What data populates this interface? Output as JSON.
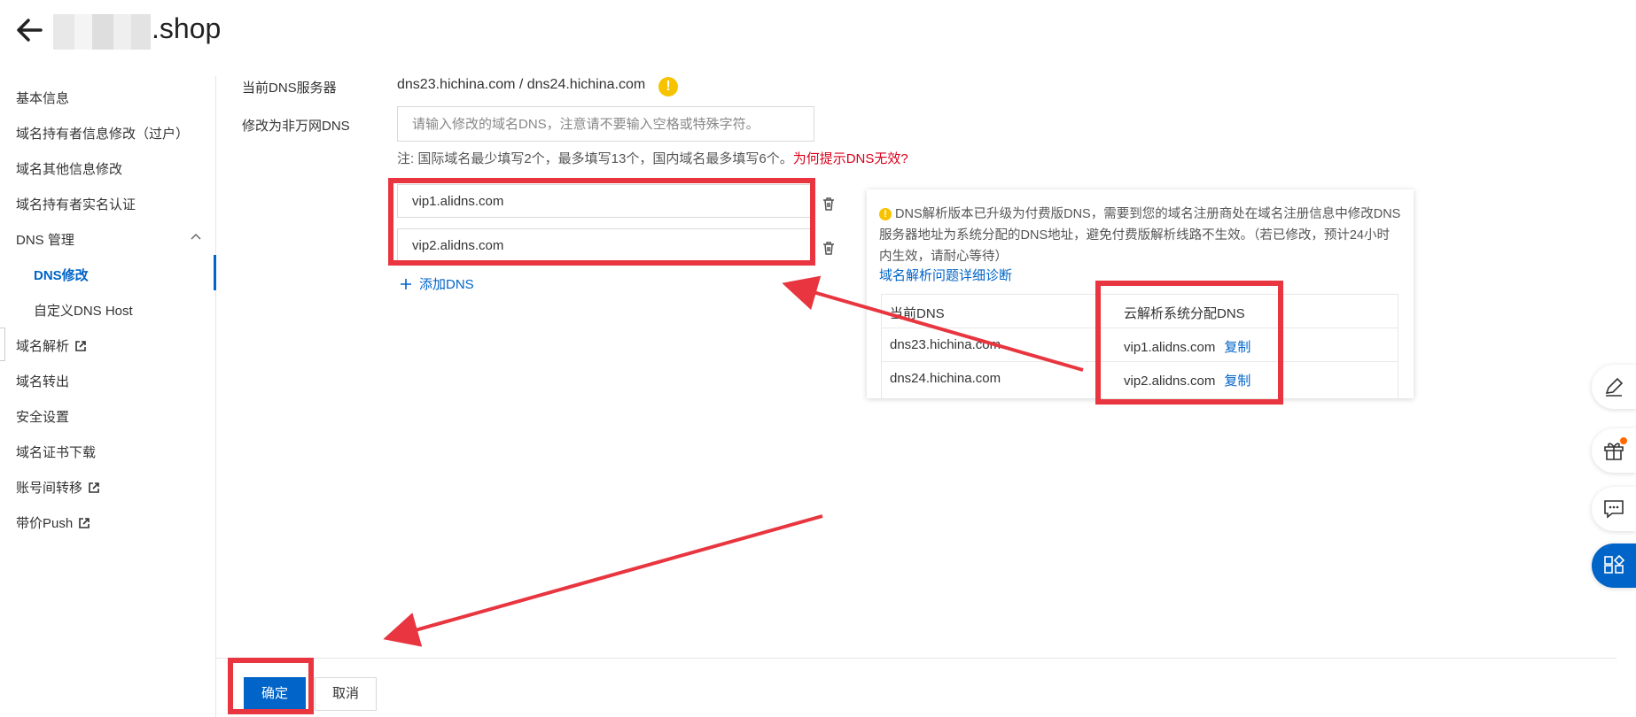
{
  "header": {
    "domain_suffix": ".shop",
    "back_label": "back"
  },
  "sidebar": {
    "items": [
      {
        "label": "基本信息"
      },
      {
        "label": "域名持有者信息修改（过户）"
      },
      {
        "label": "域名其他信息修改"
      },
      {
        "label": "域名持有者实名认证"
      },
      {
        "label": "DNS 管理"
      },
      {
        "label": "DNS修改"
      },
      {
        "label": "自定义DNS Host"
      },
      {
        "label": "域名解析"
      },
      {
        "label": "域名转出"
      },
      {
        "label": "安全设置"
      },
      {
        "label": "域名证书下载"
      },
      {
        "label": "账号间转移"
      },
      {
        "label": "带价Push"
      }
    ]
  },
  "form": {
    "current_dns_label": "当前DNS服务器",
    "current_dns_value": "dns23.hichina.com / dns24.hichina.com",
    "modify_label": "修改为非万网DNS",
    "modify_placeholder": "请输入修改的域名DNS，注意请不要输入空格或特殊字符。",
    "note_text": "注:   国际域名最少填写2个，最多填写13个，国内域名最多填写6个。",
    "note_link": "为何提示DNS无效?",
    "dns1": "vip1.alidns.com",
    "dns2": "vip2.alidns.com",
    "add_dns": "添加DNS"
  },
  "panel": {
    "text": "DNS解析版本已升级为付费版DNS，需要到您的域名注册商处在域名注册信息中修改DNS服务器地址为系统分配的DNS地址，避免付费版解析线路不生效。（若已修改，预计24小时内生效，请耐心等待）",
    "link": "域名解析问题详细诊断",
    "table": {
      "headers": [
        "当前DNS",
        "云解析系统分配DNS"
      ],
      "rows": [
        {
          "current": "dns23.hichina.com",
          "assigned": "vip1.alidns.com",
          "action": "复制"
        },
        {
          "current": "dns24.hichina.com",
          "assigned": "vip2.alidns.com",
          "action": "复制"
        }
      ]
    }
  },
  "footer": {
    "confirm": "确定",
    "cancel": "取消"
  },
  "colors": {
    "accent": "#0064c8",
    "annotation": "#e8353f",
    "warning": "#f7c300",
    "link_red": "#d9001b"
  },
  "icons": [
    "back-arrow-icon",
    "external-link-icon",
    "chevron-up-icon",
    "warning-icon",
    "trash-icon",
    "plus-icon",
    "edit-icon",
    "gift-icon",
    "chat-icon",
    "apps-icon"
  ]
}
